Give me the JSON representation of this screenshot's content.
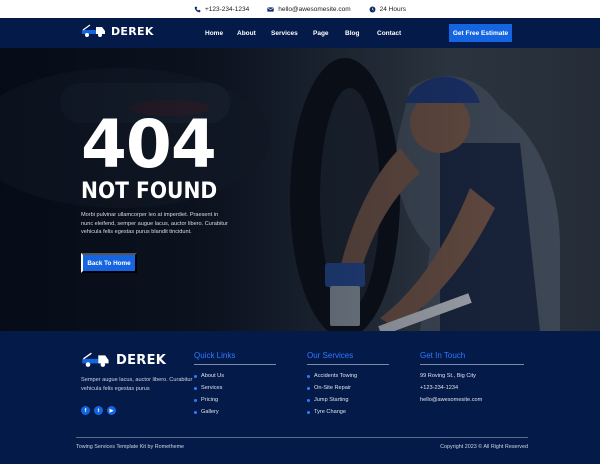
{
  "topbar": {
    "phone": "+123-234-1234",
    "email": "hello@awesomesite.com",
    "hours": "24 Hours"
  },
  "header": {
    "logo_text": "DEREK",
    "nav": [
      "Home",
      "About",
      "Services",
      "Page",
      "Blog",
      "Contact"
    ],
    "cta_label": "Get Free Estimate"
  },
  "hero": {
    "code": "404",
    "title": "NOT FOUND",
    "description": "Morbi pulvinar ullamcorper leo at imperdiet. Praesent in nunc eleifend, semper augue lacus, auctor libero. Curabitur vehicula felis egestas purus blandit tincidunt.",
    "button_label": "Back To Home"
  },
  "footer": {
    "logo_text": "DEREK",
    "description": "Semper augue lacus, auctor libero. Curabitur vehicula felis egestas purus",
    "socials": [
      "facebook-icon",
      "twitter-icon",
      "youtube-icon"
    ],
    "quick_links": {
      "title": "Quick Links",
      "items": [
        "About Us",
        "Services",
        "Pricing",
        "Gallery"
      ]
    },
    "services": {
      "title": "Our Services",
      "items": [
        "Accidents Towing",
        "On-Site Repair",
        "Jump Starting",
        "Tyre Change"
      ]
    },
    "contact": {
      "title": "Get In Touch",
      "items": [
        "99 Roving St., Big City",
        "+123-234-1234",
        "hello@awesomesite.com"
      ]
    },
    "copyright_left": "Towing Services Template Kit by Rometheme",
    "copyright_right": "Copyright 2023 © All Right Reserved"
  },
  "colors": {
    "navy": "#041a49",
    "accent": "#1565e0",
    "link_blue": "#2f7bff"
  }
}
